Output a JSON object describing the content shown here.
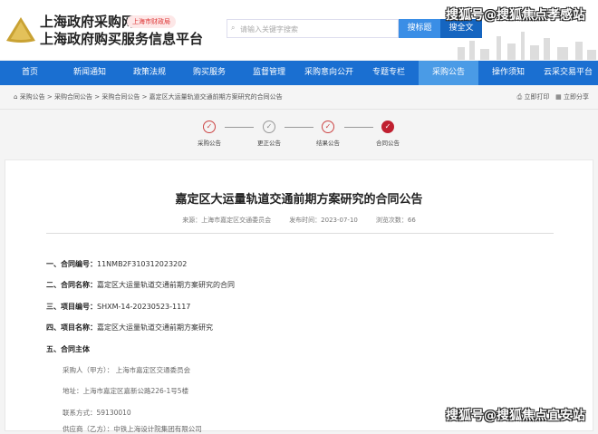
{
  "header": {
    "site_name": "上海政府采购网",
    "site_subtitle": "上海政府购买服务信息平台",
    "badge": "上海市财政局",
    "search_placeholder": "请输入关键字搜索",
    "search_title_btn": "搜标题",
    "search_full_btn": "搜全文"
  },
  "watermarks": {
    "top": "搜狐号@搜狐焦点孝感站",
    "bottom": "搜狐号@搜狐焦点宜安站"
  },
  "nav": [
    "首页",
    "新闻通知",
    "政策法规",
    "购买服务",
    "监督管理",
    "采购意向公开",
    "专题专栏",
    "采购公告",
    "操作须知",
    "云采交易平台"
  ],
  "breadcrumb": [
    "采购公告",
    "采购合同公告",
    "采购合同公告",
    "嘉定区大运量轨道交通前期方案研究的合同公告"
  ],
  "actions": {
    "print": "立即打印",
    "share": "立即分享"
  },
  "steps": [
    "采购公告",
    "更正公告",
    "结果公告",
    "合同公告"
  ],
  "article": {
    "title": "嘉定区大运量轨道交通前期方案研究的合同公告",
    "source": "来源：上海市嘉定区交通委员会",
    "date": "发布时间：2023-07-10",
    "views": "浏览次数：66",
    "items": [
      {
        "label": "一、合同编号：",
        "value": "11NMB2F310312023202"
      },
      {
        "label": "二、合同名称：",
        "value": "嘉定区大运量轨道交通前期方案研究的合同"
      },
      {
        "label": "三、项目编号：",
        "value": "SHXM-14-20230523-1117"
      },
      {
        "label": "四、项目名称：",
        "value": "嘉定区大运量轨道交通前期方案研究"
      },
      {
        "label": "五、合同主体",
        "value": ""
      }
    ],
    "parties": [
      "采购人（甲方）： 上海市嘉定区交通委员会",
      "地址：上海市嘉定区嘉新公路226-1号5楼",
      "联系方式：59130010",
      "供应商（乙方）：中铁上海设计院集团有限公司"
    ]
  }
}
